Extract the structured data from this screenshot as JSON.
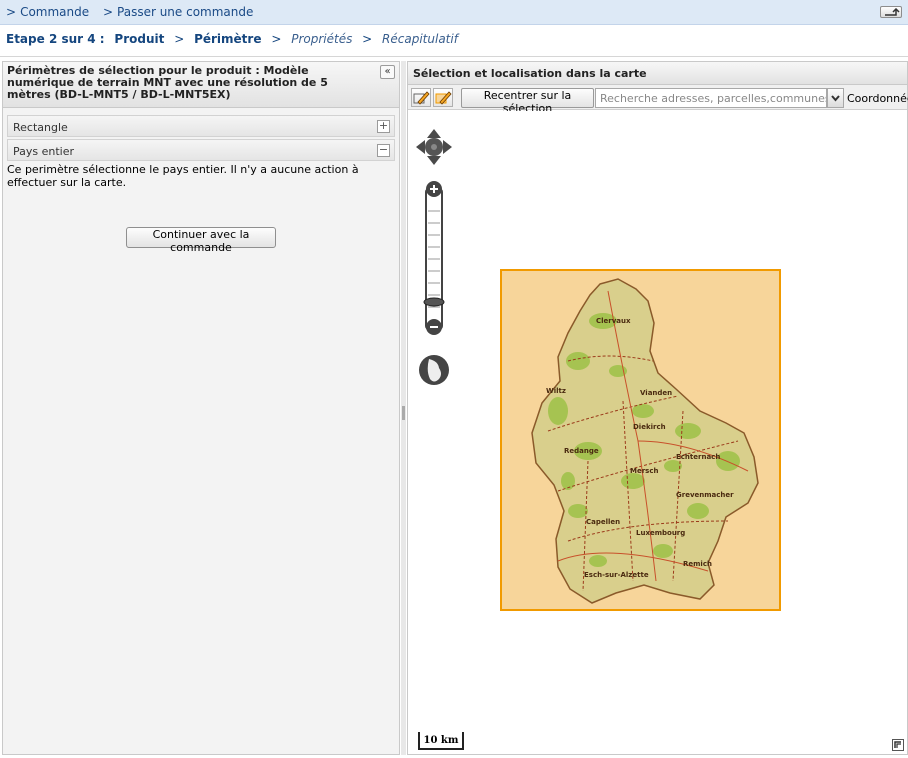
{
  "breadcrumb": {
    "sep": ">",
    "items": [
      "Commande",
      "Passer une commande"
    ]
  },
  "steps": {
    "prefix": "Etape 2 sur 4 :",
    "sep": ">",
    "items": [
      {
        "label": "Produit",
        "state": "done"
      },
      {
        "label": "Périmètre",
        "state": "current"
      },
      {
        "label": "Propriétés",
        "state": "todo"
      },
      {
        "label": "Récapitulatif",
        "state": "todo"
      }
    ]
  },
  "left_panel": {
    "title": "Périmètres de sélection pour le produit : Modèle numérique de terrain MNT avec une résolution de 5 mètres (BD-L-MNT5 / BD-L-MNT5EX)",
    "collapse_glyph": "«",
    "accordion": [
      {
        "label": "Rectangle",
        "toggle": "+"
      },
      {
        "label": "Pays entier",
        "toggle": "−"
      }
    ],
    "description": "Ce perimètre sélectionne le pays entier. Il n'y a aucune action à effectuer sur la carte.",
    "continue_label": "Continuer avec la commande"
  },
  "right_panel": {
    "title": "Sélection et localisation dans la carte",
    "recenter_label": "Recentrer sur la sélection",
    "search_placeholder": "Recherche adresses, parcelles,communes, localités",
    "coords_label": "Coordonnées",
    "scale_label": "10 km"
  },
  "map": {
    "place_names": [
      "Clervaux",
      "Wiltz",
      "Diekirch",
      "Vianden",
      "Redange",
      "Mersch",
      "Echternach",
      "Grevenmacher",
      "Capellen",
      "Luxembourg",
      "Esch-sur-Alzette",
      "Remich"
    ],
    "selection_fill": "#f7d59a",
    "selection_border": "#f19a00"
  },
  "colors": {
    "breadcrumb_bg": "#dde9f6",
    "link": "#1a4a86"
  }
}
